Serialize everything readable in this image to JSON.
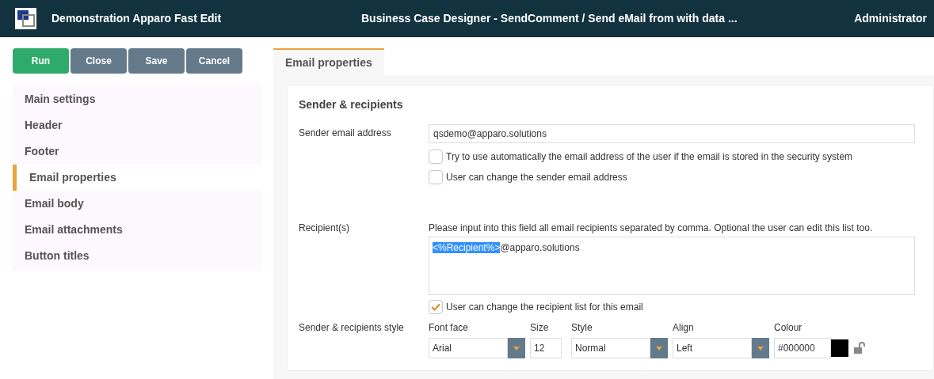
{
  "header": {
    "app_title": "Demonstration Apparo Fast Edit",
    "page_title": "Business Case Designer - SendComment / Send eMail from with data ...",
    "user": "Administrator"
  },
  "buttons": [
    {
      "label": "Run",
      "kind": "primary"
    },
    {
      "label": "Close",
      "kind": "secondary"
    },
    {
      "label": "Save",
      "kind": "secondary"
    },
    {
      "label": "Cancel",
      "kind": "secondary"
    }
  ],
  "sidebar": {
    "items": [
      {
        "label": "Main settings",
        "selected": false
      },
      {
        "label": "Header",
        "selected": false
      },
      {
        "label": "Footer",
        "selected": false
      },
      {
        "label": "Email properties",
        "selected": true
      },
      {
        "label": "Email body",
        "selected": false
      },
      {
        "label": "Email attachments",
        "selected": false
      },
      {
        "label": "Button titles",
        "selected": false
      }
    ]
  },
  "tabs": [
    {
      "label": "Email properties",
      "selected": true
    }
  ],
  "section": {
    "title": "Sender & recipients",
    "sender": {
      "label": "Sender email address",
      "value": "qsdemo@apparo.solutions",
      "options": [
        {
          "label": "Try to use automatically the email address of the user if the email is stored in the security system",
          "checked": false
        },
        {
          "label": "User can change the sender email address",
          "checked": false
        }
      ]
    },
    "recipients": {
      "label": "Recipient(s)",
      "hint": "Please input into this field all email recipients separated by comma. Optional the user can edit this list too.",
      "selected_text": "<%Recipient%>",
      "text": "@apparo.solutions",
      "options": [
        {
          "label": "User can change the recipient list for this email",
          "checked": true
        }
      ]
    },
    "style": {
      "label": "Sender & recipients style",
      "locked": false,
      "fields": [
        {
          "label": "Font face",
          "kind": "select",
          "value": "Arial"
        },
        {
          "label": "Size",
          "kind": "text",
          "value": "12"
        },
        {
          "label": "Style",
          "kind": "select",
          "value": "Normal"
        },
        {
          "label": "Align",
          "kind": "select",
          "value": "Left"
        },
        {
          "label": "Colour",
          "kind": "color",
          "value": "#000000",
          "color": "#000000"
        }
      ]
    }
  }
}
